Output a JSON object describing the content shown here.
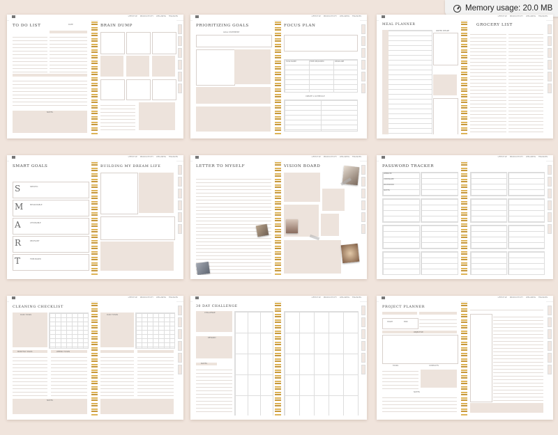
{
  "memory": {
    "label": "Memory usage: 20.0 MB"
  },
  "tabs": [
    "LIFESTYLE",
    "PRODUCTIVITY",
    "WELLNESS",
    "FINANCES"
  ],
  "pages": {
    "p1": {
      "left_title": "TO DO LIST",
      "right_title": "BRAIN DUMP",
      "date": "DATE",
      "notes": "NOTES"
    },
    "p2": {
      "left_title": "PRIORITIZING GOALS",
      "right_title": "FOCUS PLAN",
      "goal": "GOAL STATEMENT",
      "plan": "STEPS",
      "schedule": "CREATE A SCHEDULE",
      "cols": [
        "TASK NAME",
        "TIME REQUIRED",
        "DEADLINE"
      ],
      "sched_cols": [
        "SCHEDULE",
        "COMPLETED"
      ]
    },
    "p3": {
      "left_title": "MEAL PLANNER",
      "right_title": "GROCERY LIST",
      "water": "WATER INTAKE",
      "notes": "SNACK IDEAS"
    },
    "p4": {
      "left_title": "SMART GOALS",
      "right_title": "BUILDING MY DREAM LIFE",
      "items": [
        "SPECIFIC",
        "MEASURABLE",
        "ATTAINABLE",
        "RELEVANT",
        "TIME-BASED"
      ],
      "letters": [
        "S",
        "M",
        "A",
        "R",
        "T"
      ]
    },
    "p5": {
      "left_title": "LETTER TO MYSELF",
      "right_title": "VISION BOARD"
    },
    "p6": {
      "title": "PASSWORD TRACKER",
      "fields": [
        "WEBSITE",
        "USERNAME",
        "PASSWORD",
        "NOTES"
      ]
    },
    "p7": {
      "left_title": "CLEANING CHECKLIST",
      "daily": "DAILY TASKS",
      "weekly": "WEEKLY TASKS",
      "monthly": "MONTHLY TASKS",
      "notes": "NOTES",
      "days": [
        "MON",
        "TUE",
        "WED",
        "THU",
        "FRI",
        "SAT",
        "SUN"
      ]
    },
    "p8": {
      "title": "30 DAY CHALLENGE",
      "challenge": "CHALLENGE",
      "reward": "REWARD",
      "notes": "NOTES"
    },
    "p9": {
      "title": "PROJECT PLANNER",
      "start": "START",
      "end": "END",
      "objective": "OBJECTIVE",
      "tasks": "TASKS",
      "contacts": "CONTACTS",
      "notes": "NOTES"
    }
  }
}
